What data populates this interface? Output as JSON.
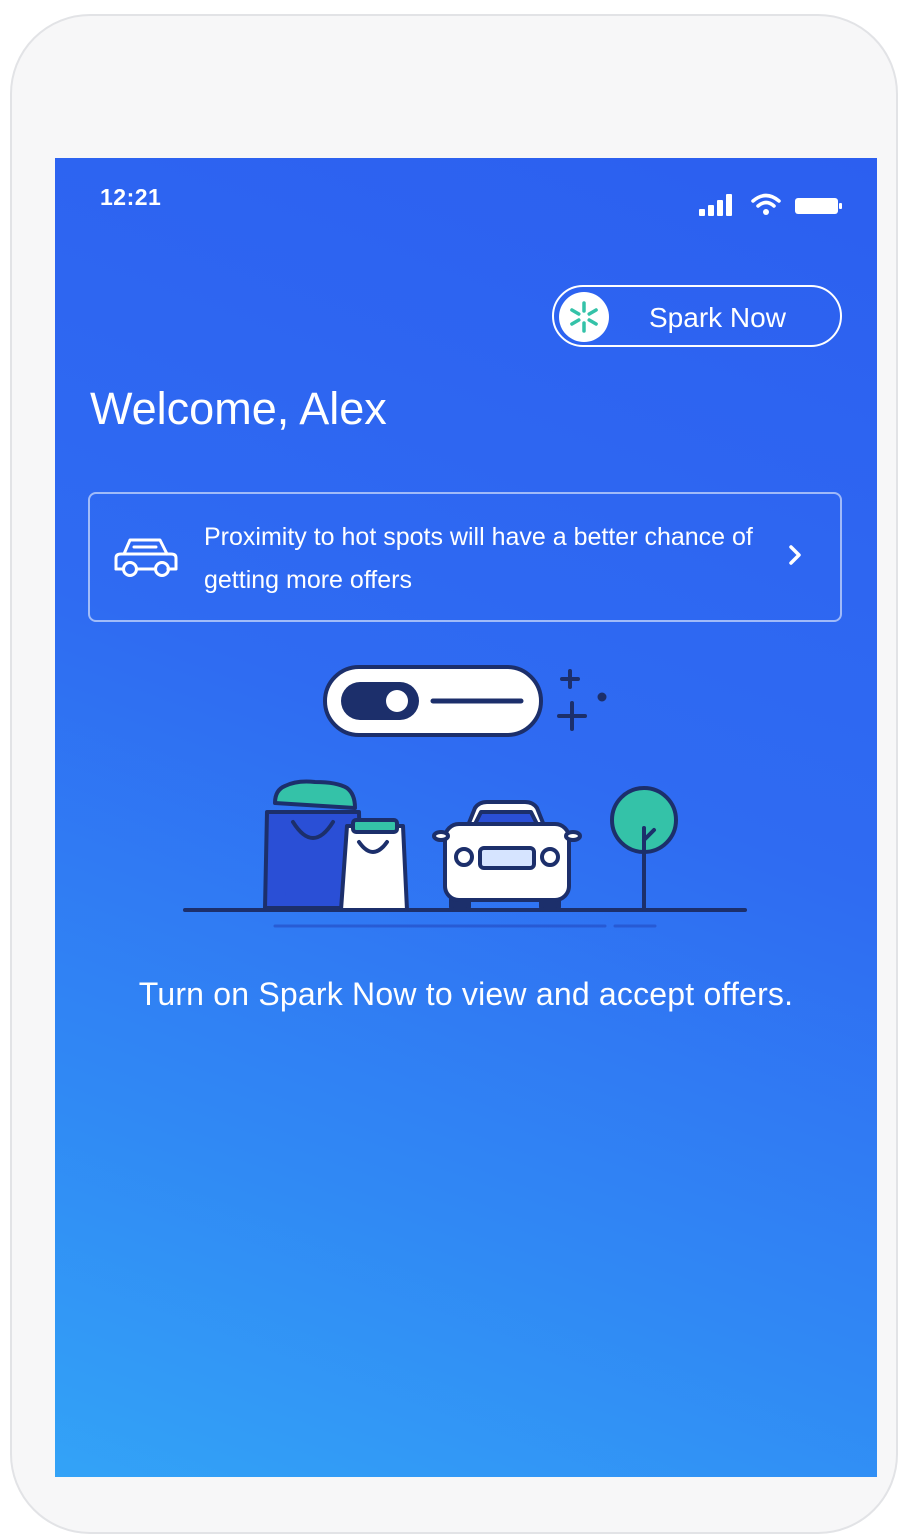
{
  "status_bar": {
    "time": "12:21",
    "icons": [
      "signal-icon",
      "wifi-icon",
      "battery-icon"
    ]
  },
  "spark_toggle": {
    "label": "Spark Now",
    "icon": "spark-icon",
    "icon_color": "#34c2a8"
  },
  "welcome": {
    "title": "Welcome, Alex"
  },
  "tip": {
    "icon": "car-icon",
    "text": "Proximity to hot spots will have a better chance of getting more offers",
    "chevron": "chevron-right-icon"
  },
  "illustration": {
    "toggle_state": "off",
    "items": [
      "sparkle-icon",
      "shopping-bags",
      "car",
      "tree"
    ]
  },
  "cta": {
    "text": "Turn on Spark Now to view and accept offers."
  },
  "colors": {
    "gradient_top": "#2c5ff0",
    "gradient_bottom": "#33a3f7",
    "accent_green": "#34c2a8",
    "dark_navy": "#1c2f6b"
  }
}
